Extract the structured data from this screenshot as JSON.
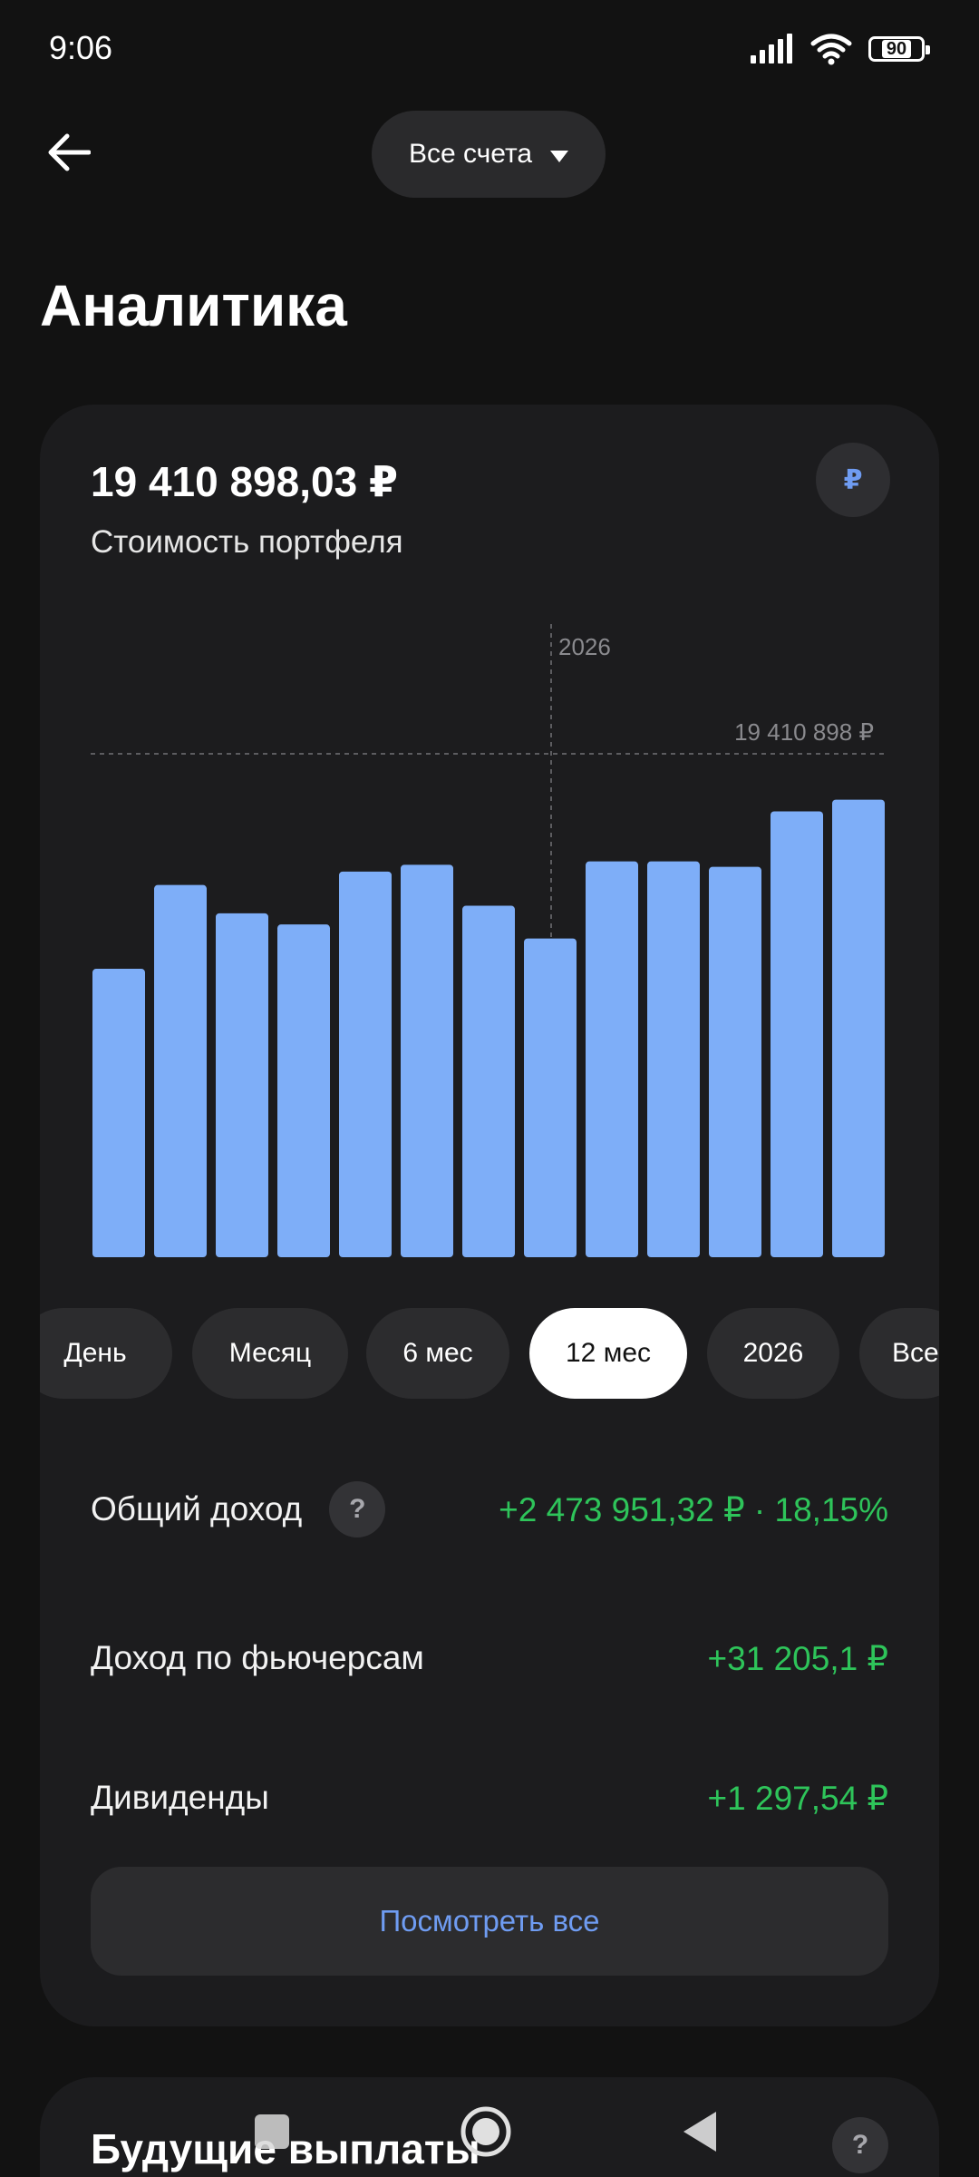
{
  "status_bar": {
    "time": "9:06",
    "battery": "90"
  },
  "header": {
    "account_selector": "Все счета"
  },
  "page_title": "Аналитика",
  "portfolio": {
    "value": "19 410 898,03 ₽",
    "label": "Стоимость портфеля",
    "currency_symbol": "₽"
  },
  "chart_data": {
    "type": "bar",
    "annotations": {
      "year_marker": "2026",
      "max_label": "19 410 898 ₽"
    },
    "values": [
      11.12,
      14.35,
      13.26,
      12.83,
      14.87,
      15.13,
      13.55,
      12.29,
      15.26,
      15.26,
      15.05,
      17.19,
      17.64
    ],
    "reference_value": 19.41,
    "ylim": [
      0,
      19.41
    ],
    "bar_color": "#7eaef8"
  },
  "periods": {
    "items": [
      "День",
      "Месяц",
      "6 мес",
      "12 мес",
      "2026",
      "Все"
    ],
    "selected": "12 мес"
  },
  "stats": {
    "total_income": {
      "label": "Общий доход",
      "help": "?",
      "value": "+2 473 951,32 ₽ · 18,15%"
    },
    "futures_income": {
      "label": "Доход по фьючерсам",
      "value": "+31 205,1 ₽"
    },
    "dividends": {
      "label": "Дивиденды",
      "value": "+1 297,54 ₽"
    }
  },
  "view_all_label": "Посмотреть все",
  "future_payments": {
    "title": "Будущие выплаты",
    "help": "?"
  },
  "colors": {
    "accent": "#6f9cf2",
    "positive": "#2ec45a",
    "background": "#121212",
    "card": "#1c1c1e"
  }
}
